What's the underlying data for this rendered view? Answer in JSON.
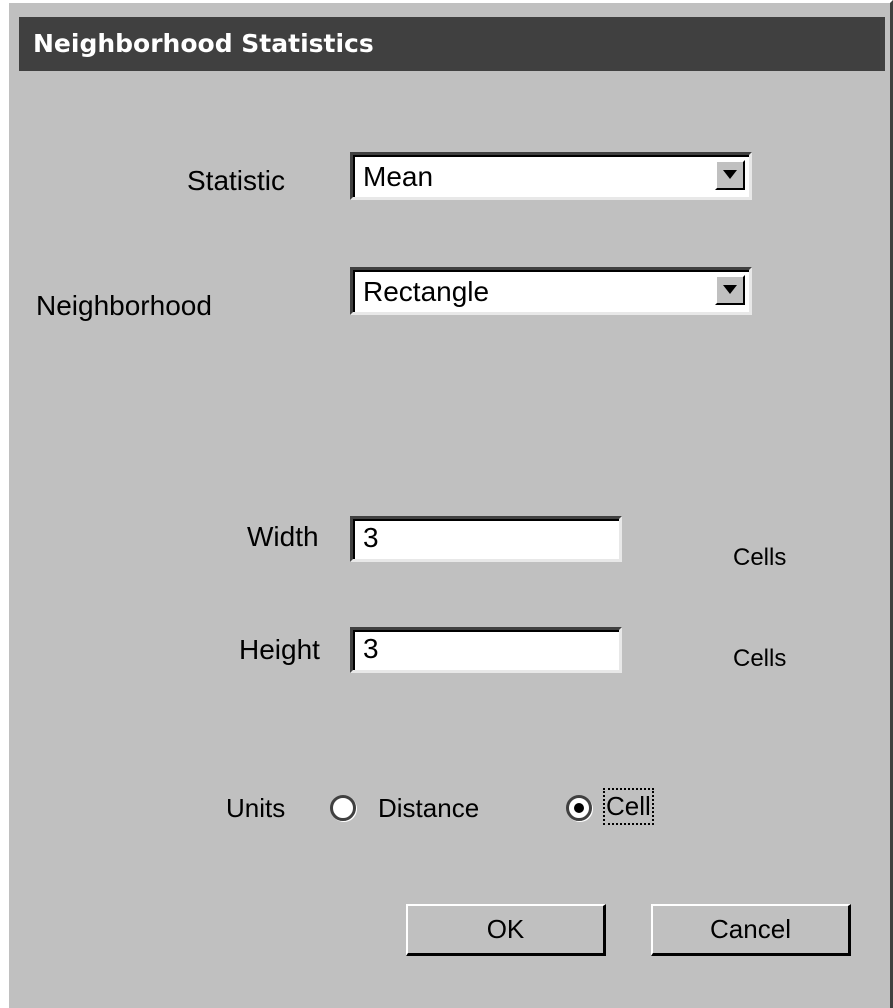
{
  "window": {
    "title": "Neighborhood Statistics"
  },
  "form": {
    "statistic_label": "Statistic",
    "statistic_value": "Mean",
    "neighborhood_label": "Neighborhood",
    "neighborhood_value": "Rectangle",
    "width_label": "Width",
    "width_value": "3",
    "width_unit": "Cells",
    "height_label": "Height",
    "height_value": "3",
    "height_unit": "Cells",
    "units_label": "Units",
    "units_options": [
      "Distance",
      "Cell"
    ],
    "units_selected": "Cell"
  },
  "buttons": {
    "ok_label": "OK",
    "cancel_label": "Cancel"
  },
  "icons": {
    "dropdown": "chevron-down-icon",
    "radio": "radio-button-icon"
  }
}
